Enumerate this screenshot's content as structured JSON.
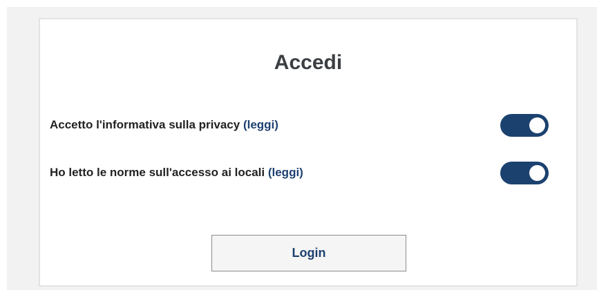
{
  "form": {
    "title": "Accedi",
    "consents": [
      {
        "label": "Accetto l'informativa sulla privacy",
        "link_text": "(leggi)",
        "checked": true
      },
      {
        "label": "Ho letto le norme sull'accesso ai locali",
        "link_text": "(leggi)",
        "checked": true
      }
    ],
    "login_label": "Login"
  },
  "colors": {
    "toggle_on": "#1b416f",
    "link": "#1d4070",
    "title": "#3b3e42",
    "backdrop": "#f2f2f2"
  }
}
